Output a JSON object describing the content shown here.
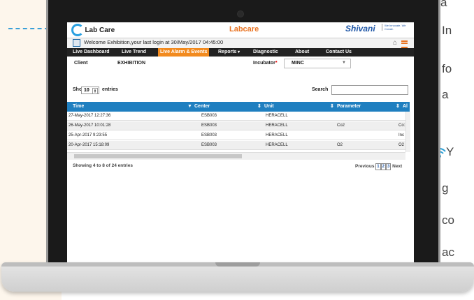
{
  "side_text": {
    "r1": "a",
    "r2": "In",
    "r3": "fo",
    "r4": "a",
    "r5": "Y",
    "r6": "g",
    "r7": "co",
    "r8": "ac"
  },
  "app": {
    "logo": "Lab Care",
    "center_title": "Labcare",
    "brand": "Shivani",
    "brand_slogan": "We Innovate. We Create.",
    "welcome": "Welcome Exhibition,your last login at 30/May/2017 04:45:00"
  },
  "nav": {
    "items": [
      "Live Dashboard",
      "Live Trend",
      "Live Alarm & Events",
      "Reports",
      "Diagnostic",
      "About",
      "Contact Us"
    ],
    "active": "Live Alarm & Events"
  },
  "filters": {
    "client_label": "Client",
    "client_value": "EXHIBITION",
    "incubator_label": "Incubator",
    "incubator_required": "*",
    "incubator_value": "MINC"
  },
  "list_controls": {
    "show_label": "Show",
    "entries_value": "10",
    "entries_label": "entries",
    "search_label": "Search"
  },
  "table": {
    "columns": [
      "Time",
      "Center",
      "Unit",
      "Parameter",
      "Al"
    ],
    "rows": [
      [
        "27-May-2017 12:27:36",
        "ESB003",
        "HERACELL",
        "",
        ""
      ],
      [
        "26-May-2017 10:01:28",
        "ESB003",
        "HERACELL",
        "Co2",
        "Co:"
      ],
      [
        "25-Apr-2017 9:23:55",
        "ESB003",
        "HERACELL",
        "",
        "Inc"
      ],
      [
        "20-Apr-2017 15:18:09",
        "ESB003",
        "HERACELL",
        "O2",
        "O2"
      ]
    ]
  },
  "footer": {
    "showing": "Showing 4 to 8 of 24 entries",
    "previous": "Previous",
    "pages": [
      "1",
      "2",
      "3"
    ],
    "next": "Next"
  },
  "colors": {
    "accent": "#f28a1e",
    "table_header": "#1f7fc0",
    "brand_blue": "#1e56a6"
  }
}
